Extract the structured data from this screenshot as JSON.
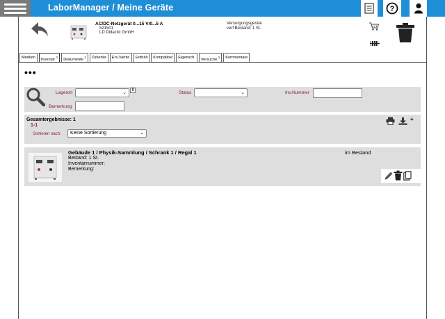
{
  "header": {
    "title": "LaborManager / Meine Geräte",
    "menu_icon": "hamburger-menu-icon",
    "doc_icon": "document-list-icon",
    "help_icon": "help-circle-icon",
    "user_icon": "user-icon",
    "accent_color": "#1e8fd6"
  },
  "device": {
    "name": "AC/DC-Netzgerät 0...15 V/0...5 A",
    "article_number": "521501",
    "manufacturer": "LD Didactic GmbH",
    "category": "Versorgungsgeräte",
    "stock": "verf.Bestand: 1 St."
  },
  "tabs": [
    {
      "label": "Medium",
      "badge": ""
    },
    {
      "label": "Inventar",
      "badge": "1"
    },
    {
      "label": "Dokumente",
      "badge": "1"
    },
    {
      "label": "Zubehör",
      "badge": ""
    },
    {
      "label": "Ers./Verbr.",
      "badge": ""
    },
    {
      "label": "Enthält",
      "badge": ""
    },
    {
      "label": "Kompatibel",
      "badge": ""
    },
    {
      "label": "Eigensch.",
      "badge": ""
    },
    {
      "label": "Versuche",
      "badge": "1"
    },
    {
      "label": "Kommentare",
      "badge": ""
    }
  ],
  "more_menu": "•••",
  "filter": {
    "lagerort_label": "Lagerort",
    "lagerort_value": "",
    "status_label": "Status",
    "status_value": "",
    "invnummer_label": "Inv.Nummer",
    "invnummer_value": "",
    "bemerkung_label": "Bemerkung",
    "bemerkung_value": ""
  },
  "results": {
    "label": "Gesamtergebnisse: 1",
    "range": "1-1",
    "sort_label": "Sortieren nach:",
    "sort_value": "Keine Sortierung"
  },
  "items": [
    {
      "location": "Gebäude 1 / Physik-Sammlung / Schrank 1 / Regal 1",
      "status": "im Bestand",
      "stock": "Bestand: 1 St.",
      "inventory_number": "Inventarnummer:",
      "remark": "Bemerkung:"
    }
  ]
}
